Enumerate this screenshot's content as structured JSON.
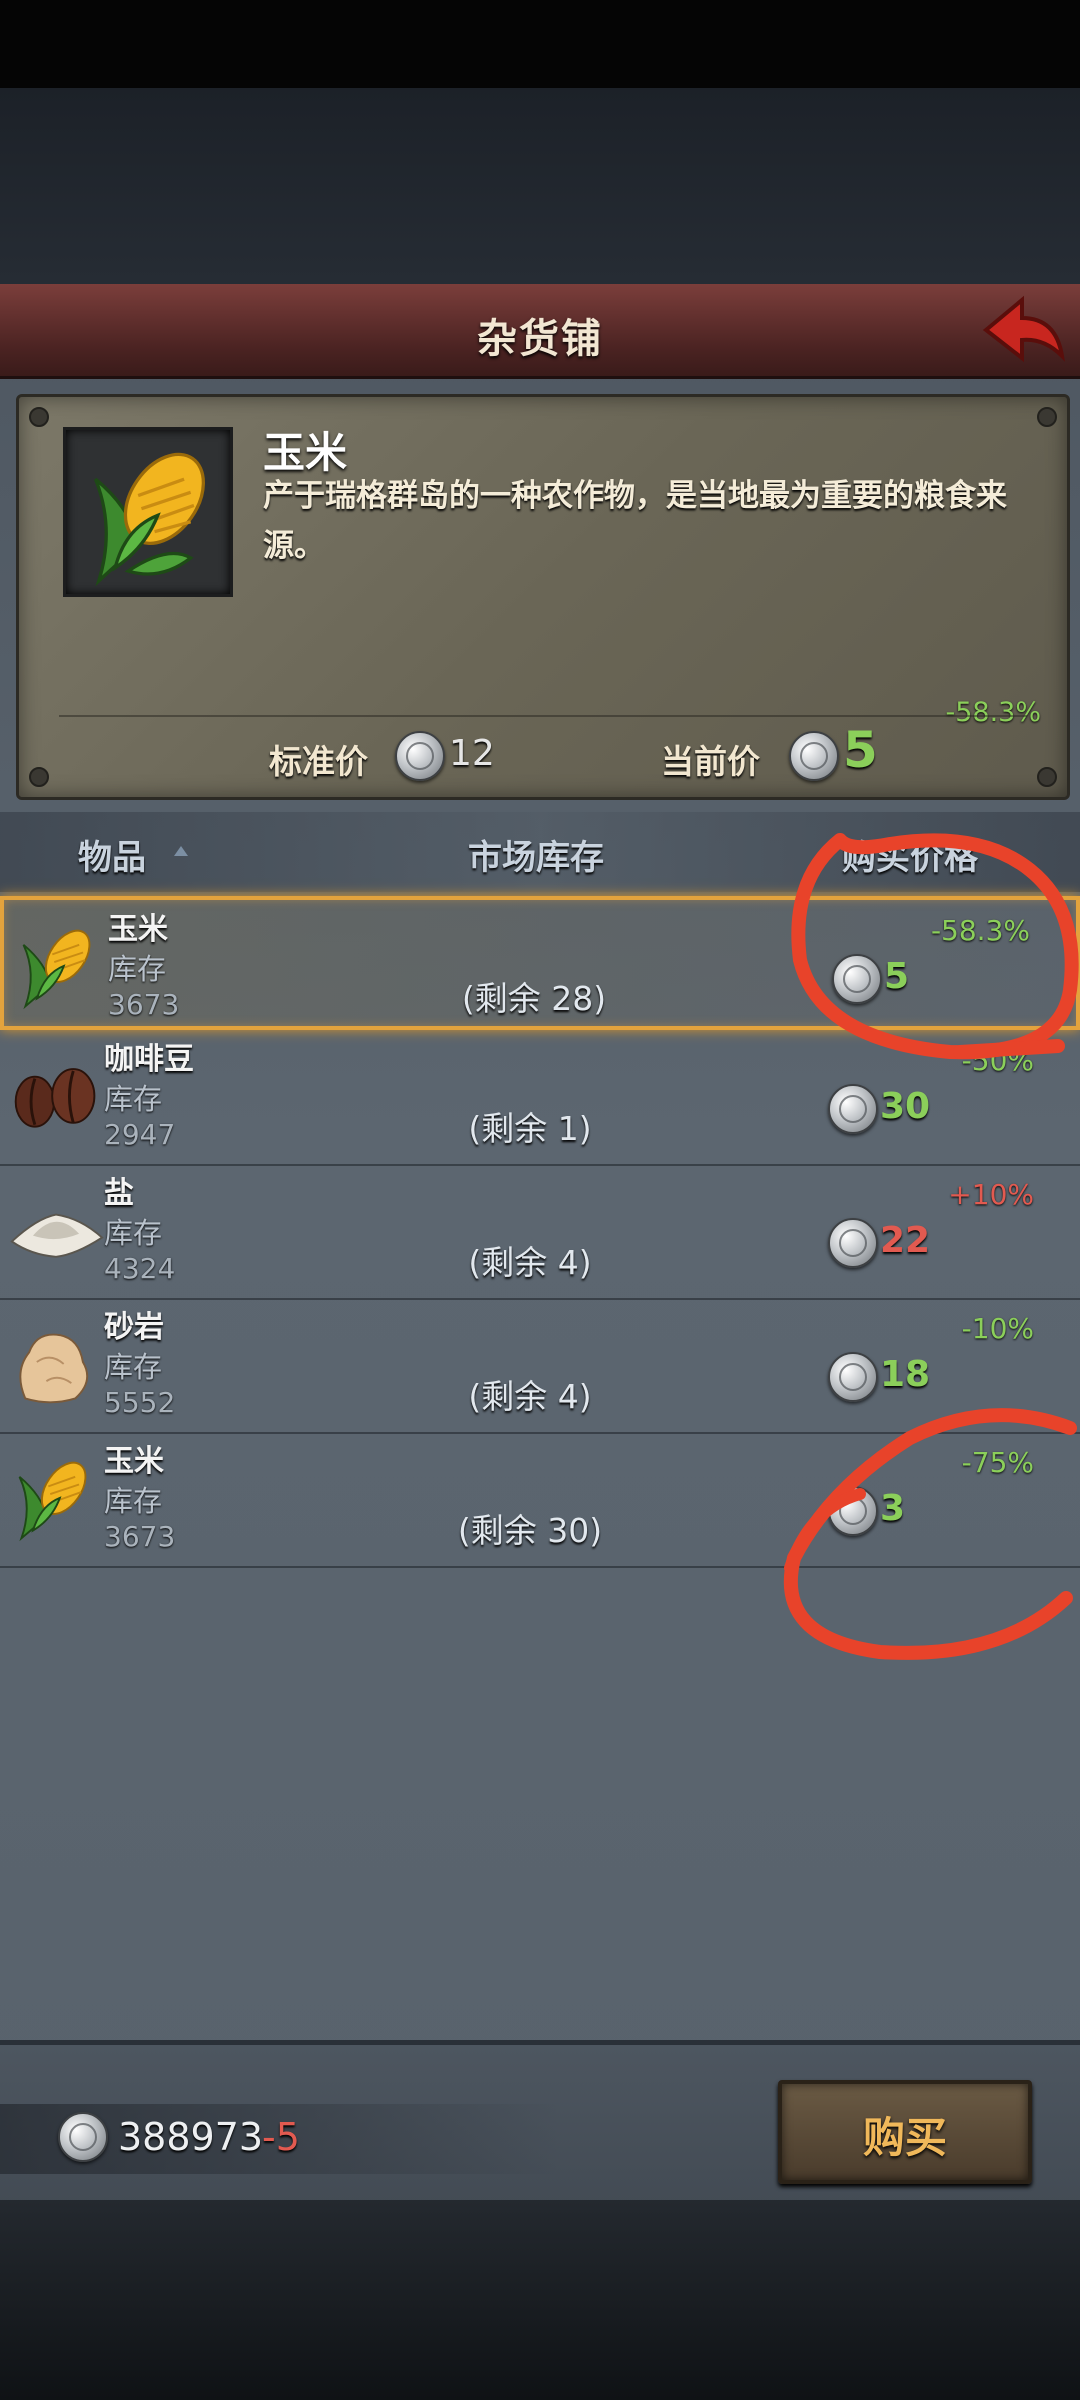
{
  "header": {
    "title": "杂货铺"
  },
  "detail": {
    "name": "玉米",
    "description": "产于瑞格群岛的一种农作物，是当地最为重要的粮食来源。",
    "discount": "-58.3%",
    "standard_price_label": "标准价",
    "standard_price": "12",
    "current_price_label": "当前价",
    "current_price": "5"
  },
  "columns": {
    "item": "物品",
    "market_stock": "市场库存",
    "buy_price": "购买价格"
  },
  "items": [
    {
      "name": "玉米",
      "stock_label": "库存",
      "stock": "3673",
      "remaining": "(剩余 28)",
      "price": "5",
      "delta": "-58.3%",
      "delta_color": "green",
      "icon": "corn-icon"
    },
    {
      "name": "咖啡豆",
      "stock_label": "库存",
      "stock": "2947",
      "remaining": "(剩余 1)",
      "price": "30",
      "delta": "-50%",
      "delta_color": "green",
      "icon": "coffee-beans-icon"
    },
    {
      "name": "盐",
      "stock_label": "库存",
      "stock": "4324",
      "remaining": "(剩余 4)",
      "price": "22",
      "delta": "+10%",
      "delta_color": "red",
      "icon": "salt-icon"
    },
    {
      "name": "砂岩",
      "stock_label": "库存",
      "stock": "5552",
      "remaining": "(剩余 4)",
      "price": "18",
      "delta": "-10%",
      "delta_color": "green",
      "icon": "sandstone-icon"
    },
    {
      "name": "玉米",
      "stock_label": "库存",
      "stock": "3673",
      "remaining": "(剩余 30)",
      "price": "3",
      "delta": "-75%",
      "delta_color": "green",
      "icon": "corn-icon"
    }
  ],
  "footer": {
    "money": "388973",
    "money_change": "-5",
    "buy_label": "购买"
  },
  "colors": {
    "accent_orange": "#e3a33d",
    "positive": "#8bcf5a",
    "negative": "#e25a50",
    "annotation": "#e8432a"
  }
}
